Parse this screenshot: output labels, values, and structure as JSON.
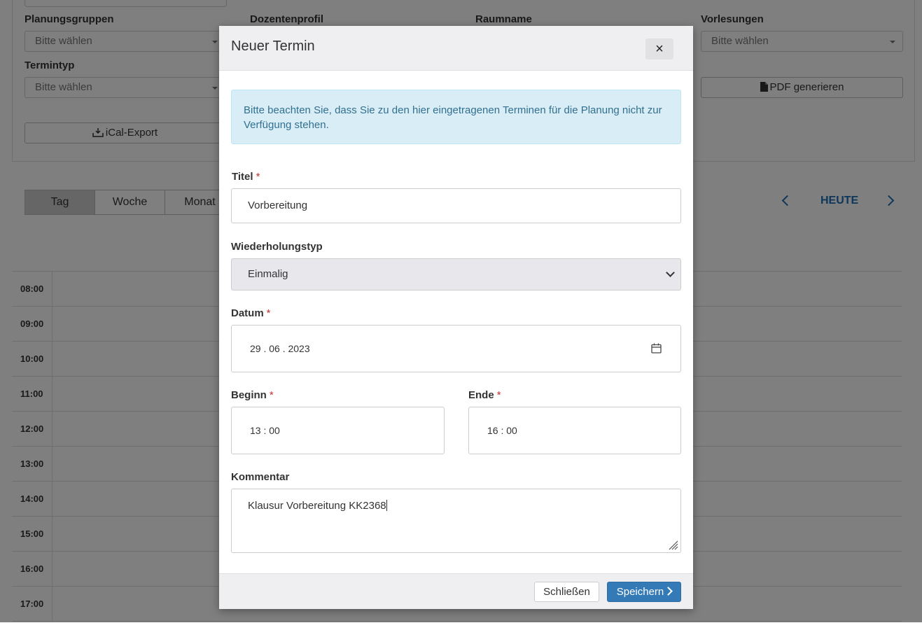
{
  "filters": {
    "planungsgruppen_label": "Planungsgruppen",
    "dozentenprofil_label": "Dozentenprofil",
    "raumname_label": "Raumname",
    "vorlesungen_label": "Vorlesungen",
    "termintyp_label": "Termintyp",
    "placeholder": "Bitte wählen",
    "ical_label": "iCal-Export",
    "pdf_label": "PDF generieren"
  },
  "view_tabs": [
    "Tag",
    "Woche",
    "Monat"
  ],
  "nav": {
    "today_label": "HEUTE"
  },
  "hours": [
    "08:00",
    "09:00",
    "10:00",
    "11:00",
    "12:00",
    "13:00",
    "14:00",
    "15:00",
    "16:00",
    "17:00"
  ],
  "modal": {
    "title": "Neuer Termin",
    "close_symbol": "×",
    "alert_text": "Bitte beachten Sie, dass Sie zu den hier eingetragenen Terminen für die Planung nicht zur Verfügung stehen.",
    "required_mark": "*",
    "titel_label": "Titel",
    "titel_value": "Vorbereitung",
    "wiederholung_label": "Wiederholungstyp",
    "wiederholung_value": "Einmalig",
    "datum_label": "Datum",
    "datum_value": "29 . 06 . 2023",
    "beginn_label": "Beginn",
    "beginn_value": "13 : 00",
    "ende_label": "Ende",
    "ende_value": "16 : 00",
    "kommentar_label": "Kommentar",
    "kommentar_value": "Klausur Vorbereitung KK2368",
    "close_button": "Schließen",
    "save_button": "Speichern"
  },
  "colors": {
    "primary": "#337ab7",
    "alert_bg": "#d9edf7",
    "alert_text": "#31708f",
    "link": "#1b6fb5"
  }
}
